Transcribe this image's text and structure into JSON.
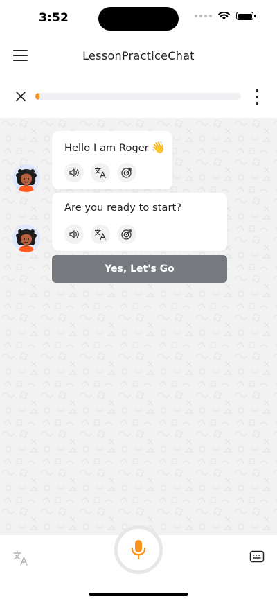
{
  "status_bar": {
    "time": "3:52"
  },
  "app_bar": {
    "title": "LessonPracticeChat"
  },
  "progress": {
    "value_percent": 2,
    "fill_color": "#f7931e"
  },
  "messages": [
    {
      "text": "Hello I am Roger",
      "emoji": "👋"
    },
    {
      "text": "Are you ready to start?",
      "emoji": ""
    }
  ],
  "cta": {
    "label": "Yes, Let's Go"
  },
  "icons": {
    "menu": "hamburger-menu-icon",
    "close": "close-icon",
    "more": "more-vertical-icon",
    "speaker": "speaker-icon",
    "translate": "translate-icon",
    "target": "target-icon",
    "mic": "microphone-icon",
    "keyboard": "keyboard-icon"
  },
  "colors": {
    "accent": "#f7931e",
    "cta_bg": "#76797d",
    "chat_bg": "#f2f2f3"
  }
}
